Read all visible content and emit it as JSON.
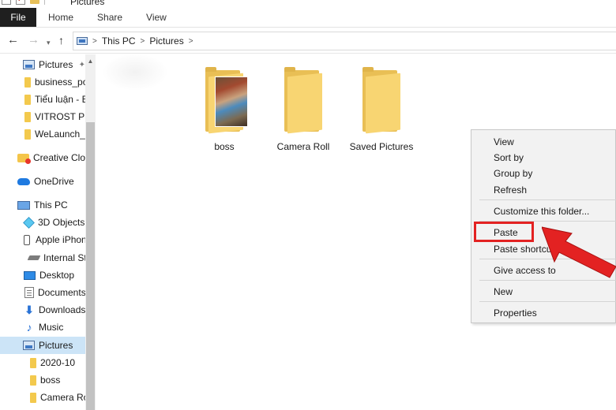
{
  "window": {
    "title": "Pictures"
  },
  "ribbon": {
    "tabs": [
      "File",
      "Home",
      "Share",
      "View"
    ]
  },
  "address": {
    "crumbs": [
      "This PC",
      "Pictures"
    ]
  },
  "sidebar": {
    "items": [
      {
        "label": "Pictures",
        "icon": "pictures-icon",
        "pinned": true
      },
      {
        "label": "business_pov",
        "icon": "folder-icon"
      },
      {
        "label": "Tiểu luận - Bả",
        "icon": "folder-icon"
      },
      {
        "label": "VITROST PPT",
        "icon": "folder-icon"
      },
      {
        "label": "WeLaunch_D",
        "icon": "folder-icon"
      },
      {
        "label": "Creative Cloud",
        "icon": "creative-cloud-icon"
      },
      {
        "label": "OneDrive",
        "icon": "onedrive-icon"
      },
      {
        "label": "This PC",
        "icon": "this-pc-icon"
      },
      {
        "label": "3D Objects",
        "icon": "cube-icon"
      },
      {
        "label": "Apple iPhone",
        "icon": "phone-icon"
      },
      {
        "label": "Internal Sto",
        "icon": "drive-icon"
      },
      {
        "label": "Desktop",
        "icon": "desktop-icon"
      },
      {
        "label": "Documents",
        "icon": "documents-icon"
      },
      {
        "label": "Downloads",
        "icon": "download-icon"
      },
      {
        "label": "Music",
        "icon": "music-icon"
      },
      {
        "label": "Pictures",
        "icon": "pictures-icon",
        "selected": true
      },
      {
        "label": "2020-10",
        "icon": "folder-icon"
      },
      {
        "label": "boss",
        "icon": "folder-icon"
      },
      {
        "label": "Camera Rol",
        "icon": "folder-icon"
      }
    ]
  },
  "folders": [
    {
      "name": "boss",
      "has_photo": true
    },
    {
      "name": "Camera Roll",
      "has_photo": false
    },
    {
      "name": "Saved Pictures",
      "has_photo": false
    }
  ],
  "context_menu": {
    "items": [
      "View",
      "Sort by",
      "Group by",
      "Refresh",
      "Customize this folder...",
      "Paste",
      "Paste shortcut",
      "Give access to",
      "New",
      "Properties"
    ],
    "highlighted": "Paste"
  },
  "colors": {
    "highlight_red": "#e32222",
    "selection_blue": "#cce4f7",
    "folder_yellow": "#f8d572"
  }
}
